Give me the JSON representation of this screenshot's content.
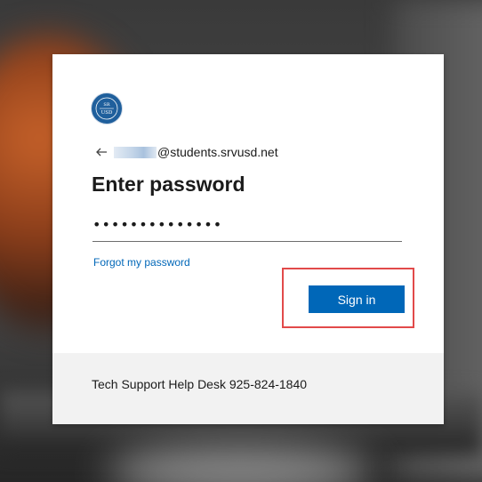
{
  "signin": {
    "logo_text": "SRVUSD",
    "account_suffix": "@students.srvusd.net",
    "title": "Enter password",
    "password_mask": "••••••••••••••",
    "forgot_label": "Forgot my password",
    "submit_label": "Sign in",
    "footer_text": "Tech Support Help Desk 925-824-1840",
    "accent_color": "#0067b8",
    "highlight_color": "#e24a4a"
  }
}
